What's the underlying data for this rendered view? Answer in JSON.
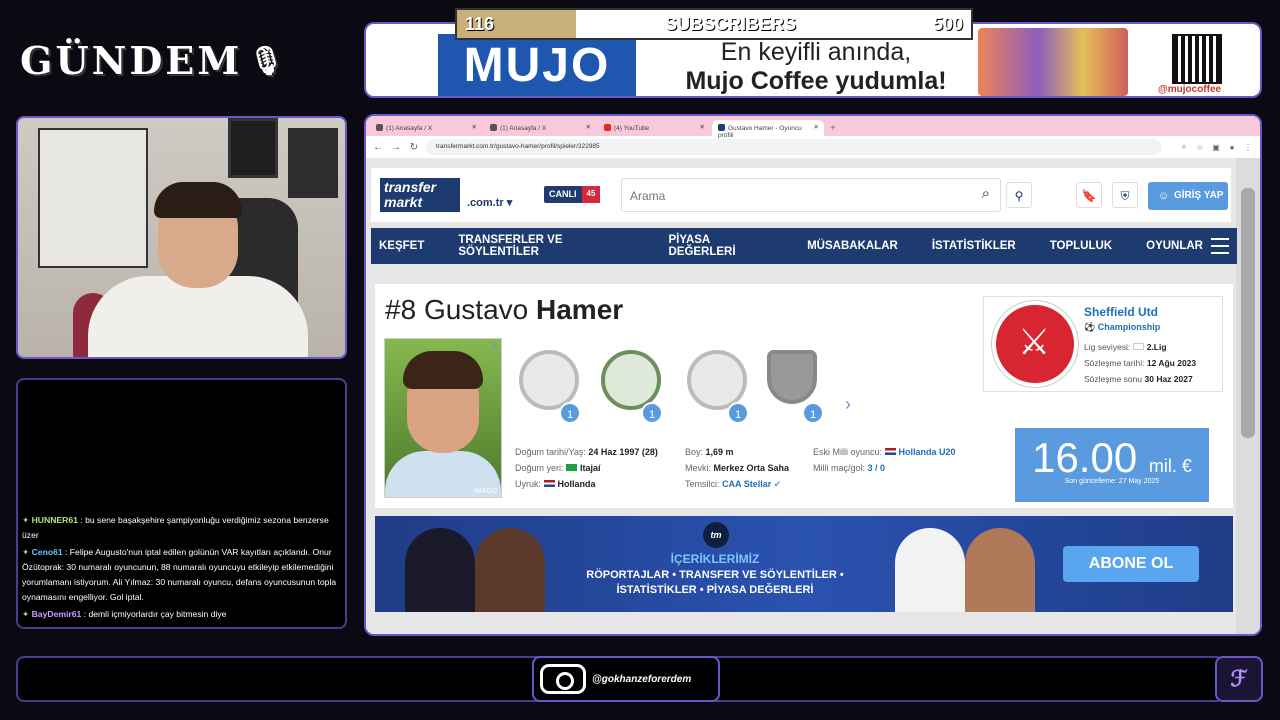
{
  "overlay": {
    "logo_text": "GÜNDEM",
    "subs": {
      "current": "116",
      "label": "SUBSCRIBERS",
      "goal": "500",
      "fraction": 0.232
    },
    "banner": {
      "brand": "MUJO",
      "slogan_line1": "En keyifli anında,",
      "slogan_line2": "Mujo Coffee yudumla!",
      "handle": "@mujocoffee"
    },
    "instagram_handle": "@gokhanzeforerdem"
  },
  "chat": [
    {
      "nick": "HUNNER61",
      "nick_color": "#b8e07a",
      "text": ": bu sene başakşehire şampiyonluğu verdiğimiz sezona benzerse üzer"
    },
    {
      "nick": "Ceno61",
      "nick_color": "#5fc8ff",
      "text": ": Felipe Augusto'nun iptal edilen golünün VAR kayıtları açıklandı. Onur Özütoprak: 30 numaralı oyuncunun, 88 numaralı oyuncuyu etkileyip etkilemediğini yorumlamanı istiyorum. Ali Yılmaz: 30 numaralı oyuncu, defans oyuncusunun topla oynamasını engelliyor. Gol iptal."
    },
    {
      "nick": "BayDemir61",
      "nick_color": "#c7a0ff",
      "text": ": demli içmiyorlardır çay bitmesin diye"
    }
  ],
  "browser": {
    "tabs": [
      {
        "label": "(1) Anasayfa / X",
        "icon": "x-icon"
      },
      {
        "label": "(1) Anasayfa / X",
        "icon": "x-icon"
      },
      {
        "label": "(4) YouTube",
        "icon": "youtube-icon"
      },
      {
        "label": "Gustavo Hamer - Oyuncu profili",
        "icon": "transfermarkt-icon"
      }
    ],
    "url": "transfermarkt.com.tr/gustavo-hamer/profil/spieler/322985"
  },
  "tm": {
    "logo_line1": "transfer",
    "logo_line2": "markt",
    "tld": ".com.tr",
    "live_label": "CANLI",
    "live_count": "45",
    "search_placeholder": "Arama",
    "login_label": "GİRİŞ YAP",
    "nav": [
      "KEŞFET",
      "TRANSFERLER VE SÖYLENTİLER",
      "PİYASA DEĞERLERİ",
      "MÜSABAKALAR",
      "İSTATİSTİKLER",
      "TOPLULUK",
      "OYUNLAR"
    ],
    "player": {
      "number": "#8",
      "first_name": "Gustavo",
      "last_name": "Hamer",
      "photo_credit": "IMAGO",
      "trophy_counts": [
        "1",
        "1",
        "1",
        "1"
      ],
      "birth_label": "Doğum tarihi/Yaş:",
      "birth_value": "24 Haz 1997 (28)",
      "birthplace_label": "Doğum yeri:",
      "birthplace_value": "Itajaí",
      "citizenship_label": "Uyruk:",
      "citizenship_value": "Hollanda",
      "height_label": "Boy:",
      "height_value": "1,69 m",
      "position_label": "Mevki:",
      "position_value": "Merkez Orta Saha",
      "agent_label": "Temsilci:",
      "agent_value": "CAA Stellar",
      "former_intl_label": "Eski Milli oyuncu:",
      "former_intl_value": "Hollanda U20",
      "caps_label": "Milli maç/gol:",
      "caps_value": "3 / 0"
    },
    "club": {
      "name": "Sheffield Utd",
      "league": "Championship",
      "level_label": "Lig seviyesi:",
      "level_value": "2.Lig",
      "joined_label": "Sözleşme tarihi:",
      "joined_value": "12 Ağu 2023",
      "expires_label": "Sözleşme sonu",
      "expires_value": "30 Haz 2027"
    },
    "market_value": {
      "value": "16.00",
      "unit": "mil. €",
      "updated": "Son güncelleme: 27 May 2025"
    },
    "ad": {
      "title": "İÇERİKLERİMİZ",
      "line1": "RÖPORTAJLAR • TRANSFER VE SÖYLENTİLER •",
      "line2": "İSTATİSTİKLER • PİYASA DEĞERLERİ",
      "cta": "ABONE OL",
      "tm_badge": "tm"
    }
  },
  "colors": {
    "accent": "#6a56c8",
    "tm_navy": "#1d3b6f",
    "tm_blue": "#5a9be0"
  }
}
